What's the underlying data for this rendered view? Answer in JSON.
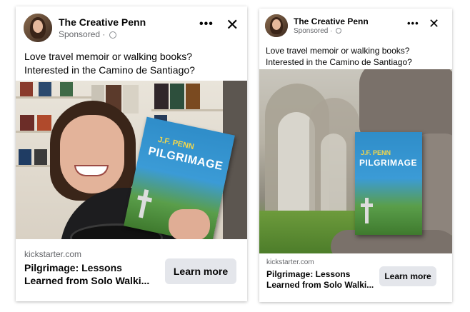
{
  "ads": [
    {
      "page_name": "The Creative Penn",
      "sponsored": "Sponsored",
      "more_icon": "•••",
      "close_icon": "✕",
      "caption_line1": "Love travel memoir or walking books?",
      "caption_line2": "Interested in the Camino de Santiago?",
      "domain": "kickstarter.com",
      "title_line1": "Pilgrimage: Lessons",
      "title_line2": "Learned from Solo Walki...",
      "cta": "Learn more",
      "book_author": "J.F. PENN",
      "book_title": "PILGRIMAGE"
    },
    {
      "page_name": "The Creative Penn",
      "sponsored": "Sponsored",
      "more_icon": "•••",
      "close_icon": "✕",
      "caption_line1": "Love travel memoir or walking books?",
      "caption_line2": "Interested in the Camino de Santiago?",
      "domain": "kickstarter.com",
      "title_line1": "Pilgrimage: Lessons",
      "title_line2": "Learned from Solo Walki...",
      "cta": "Learn more",
      "book_author": "J.F. PENN",
      "book_title": "PILGRIMAGE"
    }
  ],
  "colors": {
    "secondary_text": "#65676b",
    "button_bg": "#e4e6eb",
    "book_blue": "#2f8dc9",
    "book_author_yellow": "#f6d84a"
  }
}
